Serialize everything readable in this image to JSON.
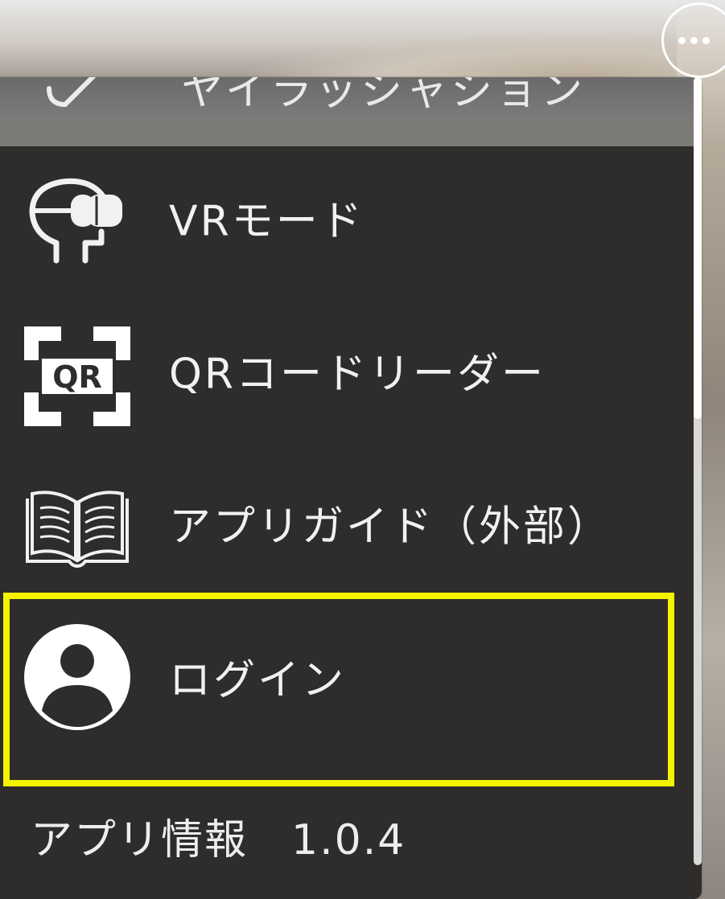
{
  "menu": {
    "partial_top_label": "ヤイラッシャション",
    "items": [
      {
        "label": "VRモード",
        "icon": "vr-headset-icon"
      },
      {
        "label": "QRコードリーダー",
        "icon": "qr-code-icon",
        "icon_text": "QR"
      },
      {
        "label": "アプリガイド（外部）",
        "icon": "book-icon"
      },
      {
        "label": "ログイン",
        "icon": "user-avatar-icon"
      }
    ],
    "app_info": "アプリ情報　1.0.4"
  },
  "more_button": {
    "icon": "more-dots-icon"
  },
  "colors": {
    "panel_bg": "#2e2d2b",
    "highlight": "#f4f400",
    "text": "#f1f1f1"
  }
}
